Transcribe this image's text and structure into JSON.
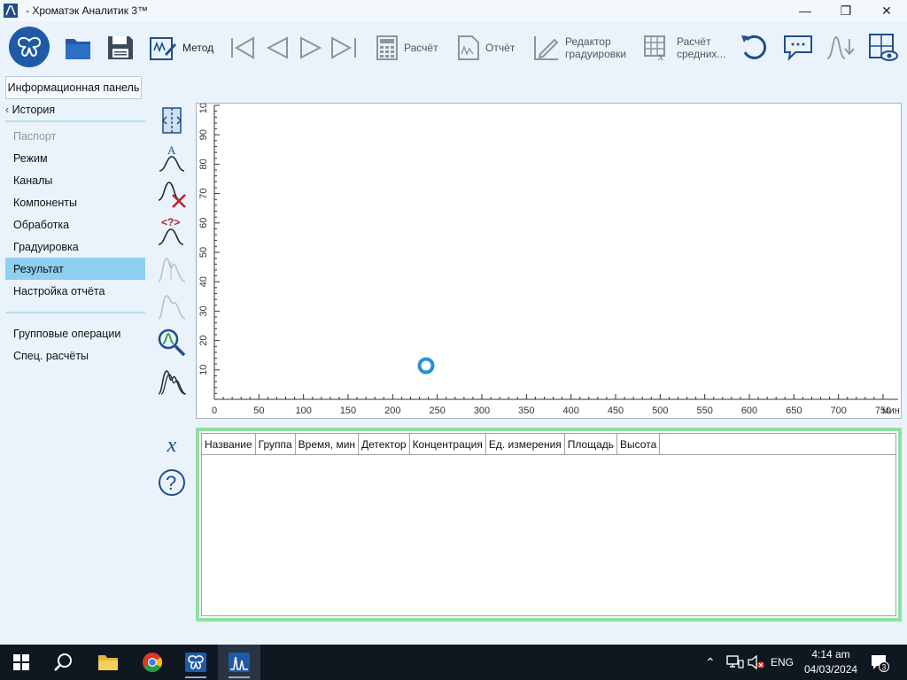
{
  "window": {
    "title": "- Хроматэк Аналитик 3™",
    "minimize": "—",
    "maximize": "❐",
    "close": "✕"
  },
  "toolbar": {
    "method_label": "Метод",
    "calc_label": "Расчёт",
    "report_label": "Отчёт",
    "calib_editor_label_1": "Редактор",
    "calib_editor_label_2": "градуировки",
    "avg_calc_label_1": "Расчёт",
    "avg_calc_label_2": "средних..."
  },
  "sidebar": {
    "info_panel_button": "Информационная панель",
    "history_label": "История",
    "items": [
      {
        "label": "Паспорт",
        "state": "disabled"
      },
      {
        "label": "Режим",
        "state": "normal"
      },
      {
        "label": "Каналы",
        "state": "normal"
      },
      {
        "label": "Компоненты",
        "state": "normal"
      },
      {
        "label": "Обработка",
        "state": "normal"
      },
      {
        "label": "Градуировка",
        "state": "normal"
      },
      {
        "label": "Результат",
        "state": "selected"
      },
      {
        "label": "Настройка отчёта",
        "state": "normal"
      }
    ],
    "extra_items": [
      {
        "label": "Групповые операции"
      },
      {
        "label": "Спец. расчёты"
      }
    ]
  },
  "tools": {
    "formula_icon_text": "x",
    "help_icon_text": "?"
  },
  "chart_data": {
    "type": "line",
    "title": "",
    "xlabel": "мин",
    "ylabel": "",
    "xlim": [
      0,
      750
    ],
    "ylim": [
      0,
      100
    ],
    "x_ticks": [
      "0",
      "50",
      "100",
      "150",
      "200",
      "250",
      "300",
      "350",
      "400",
      "450",
      "500",
      "550",
      "600",
      "650",
      "700",
      "750"
    ],
    "y_ticks": [
      "10",
      "20",
      "30",
      "40",
      "50",
      "60",
      "70",
      "80",
      "90",
      "100"
    ],
    "series": [],
    "grid": false
  },
  "results_table": {
    "columns": [
      "Название",
      "Группа",
      "Время, мин",
      "Детектор",
      "Концентрация",
      "Ед. измерения",
      "Площадь",
      "Высота"
    ],
    "rows": []
  },
  "taskbar": {
    "language": "ENG",
    "time": "4:14 am",
    "date": "04/03/2024",
    "notification_count": "3"
  },
  "colors": {
    "selected_nav": "#8ecff2",
    "table_border": "#90e0a0",
    "accent_blue": "#1f5aa6",
    "loading_spinner": "#2a8fd6"
  }
}
